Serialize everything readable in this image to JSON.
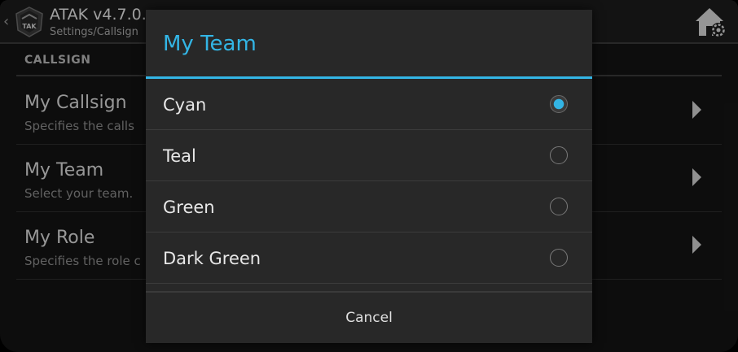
{
  "actionbar": {
    "back_glyph": "‹",
    "logo_icon": "tak-logo-icon",
    "logo_text": "TAK",
    "title": "ATAK v4.7.0.",
    "subtitle": "Settings/Callsign",
    "home_settings_icon": "home-gear-icon"
  },
  "preferences": {
    "category": "CALLSIGN",
    "items": [
      {
        "title": "My Callsign",
        "summary": "Specifies the calls"
      },
      {
        "title": "My Team",
        "summary": "Select your team."
      },
      {
        "title": "My Role",
        "summary": "Specifies the role c"
      }
    ]
  },
  "dialog": {
    "title": "My Team",
    "options": [
      {
        "label": "Cyan",
        "selected": true
      },
      {
        "label": "Teal",
        "selected": false
      },
      {
        "label": "Green",
        "selected": false
      },
      {
        "label": "Dark Green",
        "selected": false
      }
    ],
    "cancel_label": "Cancel"
  },
  "colors": {
    "accent": "#33b5e5",
    "background": "#141414",
    "dialog_background": "#282828"
  }
}
